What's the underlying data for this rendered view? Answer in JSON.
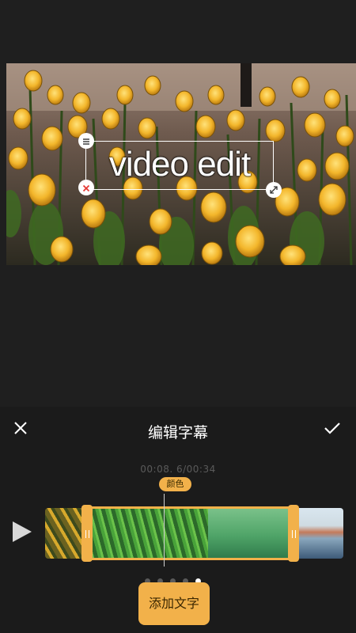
{
  "video": {
    "caption_text": "video edit"
  },
  "panel": {
    "title": "编辑字幕",
    "time_display": "00:08. 6/00:34",
    "color_tag": "颜色",
    "add_text_label": "添加文字",
    "page_dots": 5,
    "active_dot": 5
  },
  "colors": {
    "accent": "#f2b14a",
    "panel_bg": "#1b1b1b",
    "preview_bg": "#1f1f1f",
    "delete_handle": "#e53935"
  },
  "icons": {
    "close": "close-icon",
    "confirm": "checkmark-icon",
    "play": "play-icon",
    "text_style": "text-align-icon",
    "delete": "delete-x-icon",
    "resize": "resize-arrows-icon"
  }
}
